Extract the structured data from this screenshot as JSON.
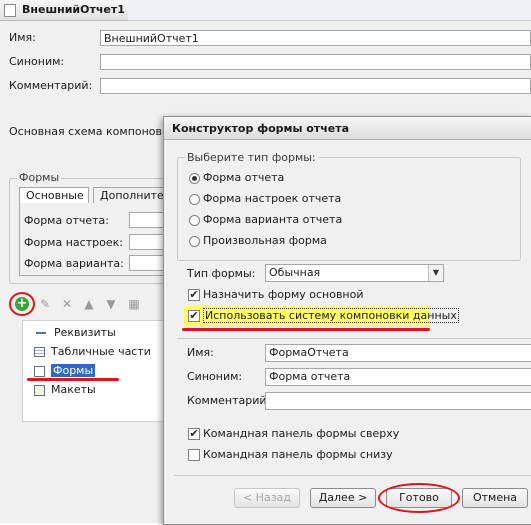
{
  "window": {
    "tab_title": "ВнешнийОтчет1 *"
  },
  "props": {
    "name_label": "Имя:",
    "name_value": "ВнешнийОтчет1",
    "synonym_label": "Синоним:",
    "synonym_value": "",
    "comment_label": "Комментарий:",
    "comment_value": "",
    "main_schema_label": "Основная схема компоновки,"
  },
  "forms_group": {
    "caption": "Формы",
    "tabs": [
      "Основные",
      "Дополнител"
    ],
    "rows": [
      "Форма отчета:",
      "Форма настроек:",
      "Форма варианта:"
    ]
  },
  "tree": {
    "items": [
      "Реквизиты",
      "Табличные части",
      "Формы",
      "Макеты"
    ]
  },
  "dialog": {
    "title": "Конструктор формы отчета",
    "form_type_group": "Выберите тип формы:",
    "radio_options": [
      "Форма отчета",
      "Форма настроек отчета",
      "Форма варианта отчета",
      "Произвольная форма"
    ],
    "selected_radio": 0,
    "form_kind_label": "Тип формы:",
    "form_kind_value": "Обычная",
    "set_main_label": "Назначить форму основной",
    "set_main_checked": true,
    "use_dcs_label": "Использовать систему компоновки данных",
    "use_dcs_checked": true,
    "name_label": "Имя:",
    "name_value": "ФормаОтчета",
    "synonym_label": "Синоним:",
    "synonym_value": "Форма отчета",
    "comment_label": "Комментарий:",
    "comment_value": "",
    "cmd_top_label": "Командная панель формы сверху",
    "cmd_top_checked": true,
    "cmd_bottom_label": "Командная панель формы снизу",
    "cmd_bottom_checked": false,
    "buttons": {
      "back": "< Назад",
      "next": "Далее >",
      "done": "Готово",
      "cancel": "Отмена"
    }
  },
  "colors": {
    "highlight_yellow": "#ffff66",
    "annotation_red": "#e1141b",
    "selection_blue": "#316ac5",
    "add_button_green": "#3aa53a"
  },
  "icons": {
    "add": "plus-circle-icon",
    "edit": "pencil-icon",
    "delete": "x-icon",
    "up": "arrow-up-icon",
    "down": "arrow-down-icon",
    "sort": "list-icon"
  }
}
